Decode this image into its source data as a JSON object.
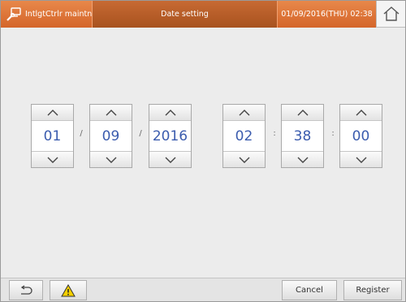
{
  "header": {
    "app_title": "IntlgtCtrlr maintnce",
    "screen_title": "Date setting",
    "datetime": "01/09/2016(THU) 02:38",
    "settings_icon": "wrench-screen-icon",
    "home_icon": "home-icon"
  },
  "fields": {
    "month": "01",
    "day": "09",
    "year": "2016",
    "hour": "02",
    "minute": "38",
    "second": "00"
  },
  "separators": {
    "date": "/",
    "time": ":"
  },
  "footer": {
    "back_icon": "back-arrow-icon",
    "warning_icon": "warning-icon",
    "cancel_label": "Cancel",
    "register_label": "Register"
  },
  "colors": {
    "header_orange": "#d4652a",
    "header_dark": "#a8521f",
    "value_blue": "#3b5cae",
    "warning_yellow": "#f5d000"
  }
}
